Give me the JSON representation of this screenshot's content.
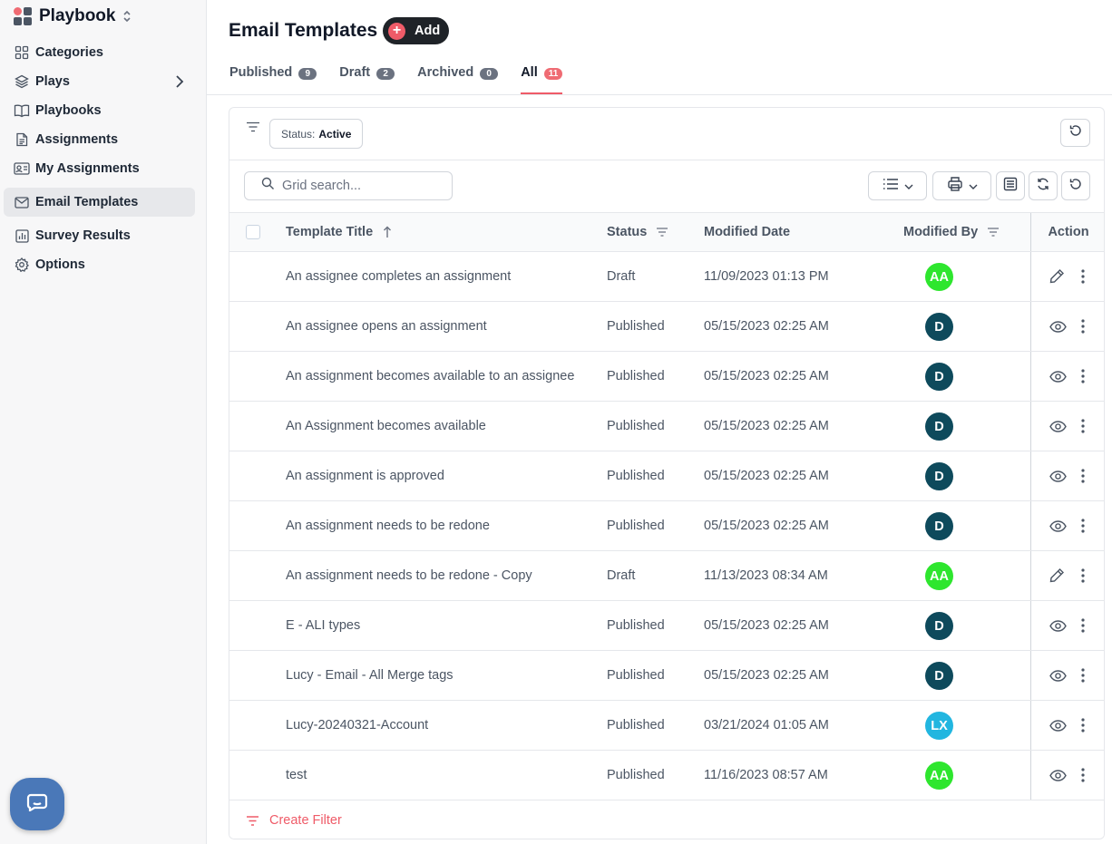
{
  "app": {
    "name": "Playbook"
  },
  "sidebar": {
    "items": [
      {
        "label": "Categories",
        "icon": "grid-icon"
      },
      {
        "label": "Plays",
        "icon": "layers-icon"
      },
      {
        "label": "Playbooks",
        "icon": "book-icon"
      },
      {
        "label": "Assignments",
        "icon": "document-icon"
      },
      {
        "label": "My Assignments",
        "icon": "id-card-icon"
      },
      {
        "label": "Email Templates",
        "icon": "mail-icon",
        "active": true
      },
      {
        "label": "Survey Results",
        "icon": "bar-chart-icon"
      },
      {
        "label": "Options",
        "icon": "gear-icon"
      }
    ]
  },
  "header": {
    "title": "Email Templates",
    "add_label": "Add"
  },
  "tabs": [
    {
      "label": "Published",
      "count": "9"
    },
    {
      "label": "Draft",
      "count": "2"
    },
    {
      "label": "Archived",
      "count": "0"
    },
    {
      "label": "All",
      "count": "11",
      "active": true
    }
  ],
  "filter": {
    "status_key": "Status:",
    "status_value": "Active"
  },
  "search": {
    "placeholder": "Grid search..."
  },
  "table": {
    "columns": {
      "title": "Template Title",
      "status": "Status",
      "modified_date": "Modified Date",
      "modified_by": "Modified By",
      "action": "Action"
    },
    "rows": [
      {
        "title": "An assignee completes an assignment",
        "status": "Draft",
        "date": "11/09/2023 01:13 PM",
        "initials": "AA",
        "avatar_color": "#2ee62e",
        "action": "edit"
      },
      {
        "title": "An assignee opens an assignment",
        "status": "Published",
        "date": "05/15/2023 02:25 AM",
        "initials": "D",
        "avatar_color": "#0e4a5c",
        "action": "view"
      },
      {
        "title": "An assignment becomes available to an assignee",
        "status": "Published",
        "date": "05/15/2023 02:25 AM",
        "initials": "D",
        "avatar_color": "#0e4a5c",
        "action": "view"
      },
      {
        "title": "An Assignment becomes available",
        "status": "Published",
        "date": "05/15/2023 02:25 AM",
        "initials": "D",
        "avatar_color": "#0e4a5c",
        "action": "view"
      },
      {
        "title": "An assignment is approved",
        "status": "Published",
        "date": "05/15/2023 02:25 AM",
        "initials": "D",
        "avatar_color": "#0e4a5c",
        "action": "view"
      },
      {
        "title": "An assignment needs to be redone",
        "status": "Published",
        "date": "05/15/2023 02:25 AM",
        "initials": "D",
        "avatar_color": "#0e4a5c",
        "action": "view"
      },
      {
        "title": "An assignment needs to be redone - Copy",
        "status": "Draft",
        "date": "11/13/2023 08:34 AM",
        "initials": "AA",
        "avatar_color": "#2ee62e",
        "action": "edit"
      },
      {
        "title": "E - ALI types",
        "status": "Published",
        "date": "05/15/2023 02:25 AM",
        "initials": "D",
        "avatar_color": "#0e4a5c",
        "action": "view"
      },
      {
        "title": "Lucy - Email - All Merge tags",
        "status": "Published",
        "date": "05/15/2023 02:25 AM",
        "initials": "D",
        "avatar_color": "#0e4a5c",
        "action": "view"
      },
      {
        "title": "Lucy-20240321-Account",
        "status": "Published",
        "date": "03/21/2024 01:05 AM",
        "initials": "LX",
        "avatar_color": "#22b6e0",
        "action": "view"
      },
      {
        "title": "test",
        "status": "Published",
        "date": "11/16/2023 08:57 AM",
        "initials": "AA",
        "avatar_color": "#2ee62e",
        "action": "view"
      }
    ]
  },
  "footer": {
    "create_filter_label": "Create Filter"
  },
  "colors": {
    "accent": "#ef5b68",
    "sidebar_bg": "#f7f7f8"
  }
}
